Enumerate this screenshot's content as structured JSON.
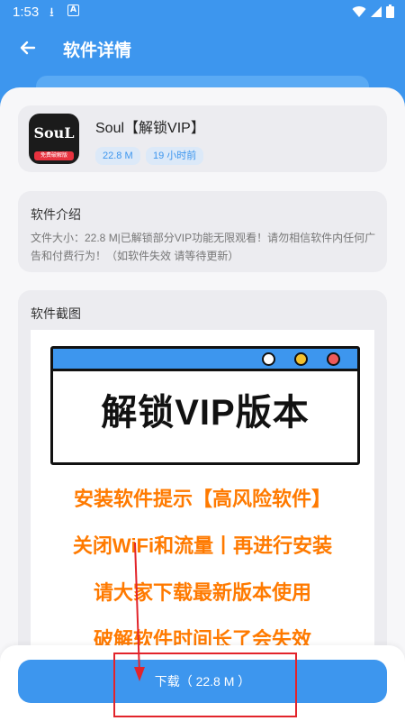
{
  "status_bar": {
    "time": "1:53"
  },
  "header": {
    "title": "软件详情"
  },
  "app": {
    "name": "Soul【解锁VIP】",
    "icon_text": "SouL",
    "icon_tag": "免费破解版",
    "size_chip": "22.8 M",
    "time_chip": "19 小时前"
  },
  "intro": {
    "title": "软件介绍",
    "text": "文件大小：22.8 M|已解锁部分VIP功能无限观看！请勿相信软件内任何广告和付费行为！（如软件失效 请等待更新）"
  },
  "screenshots": {
    "title": "软件截图",
    "banner": "解锁VIP版本",
    "lines": [
      "安装软件提示【高风险软件】",
      "关闭WiFi和流量丨再进行安装",
      "请大家下载最新版本使用",
      "破解软件时间长了会失效"
    ]
  },
  "download": {
    "label": "下载（ 22.8 M ）"
  },
  "colors": {
    "accent": "#3d96ee",
    "promo": "#ff7a00",
    "annotation": "#e2242b"
  }
}
